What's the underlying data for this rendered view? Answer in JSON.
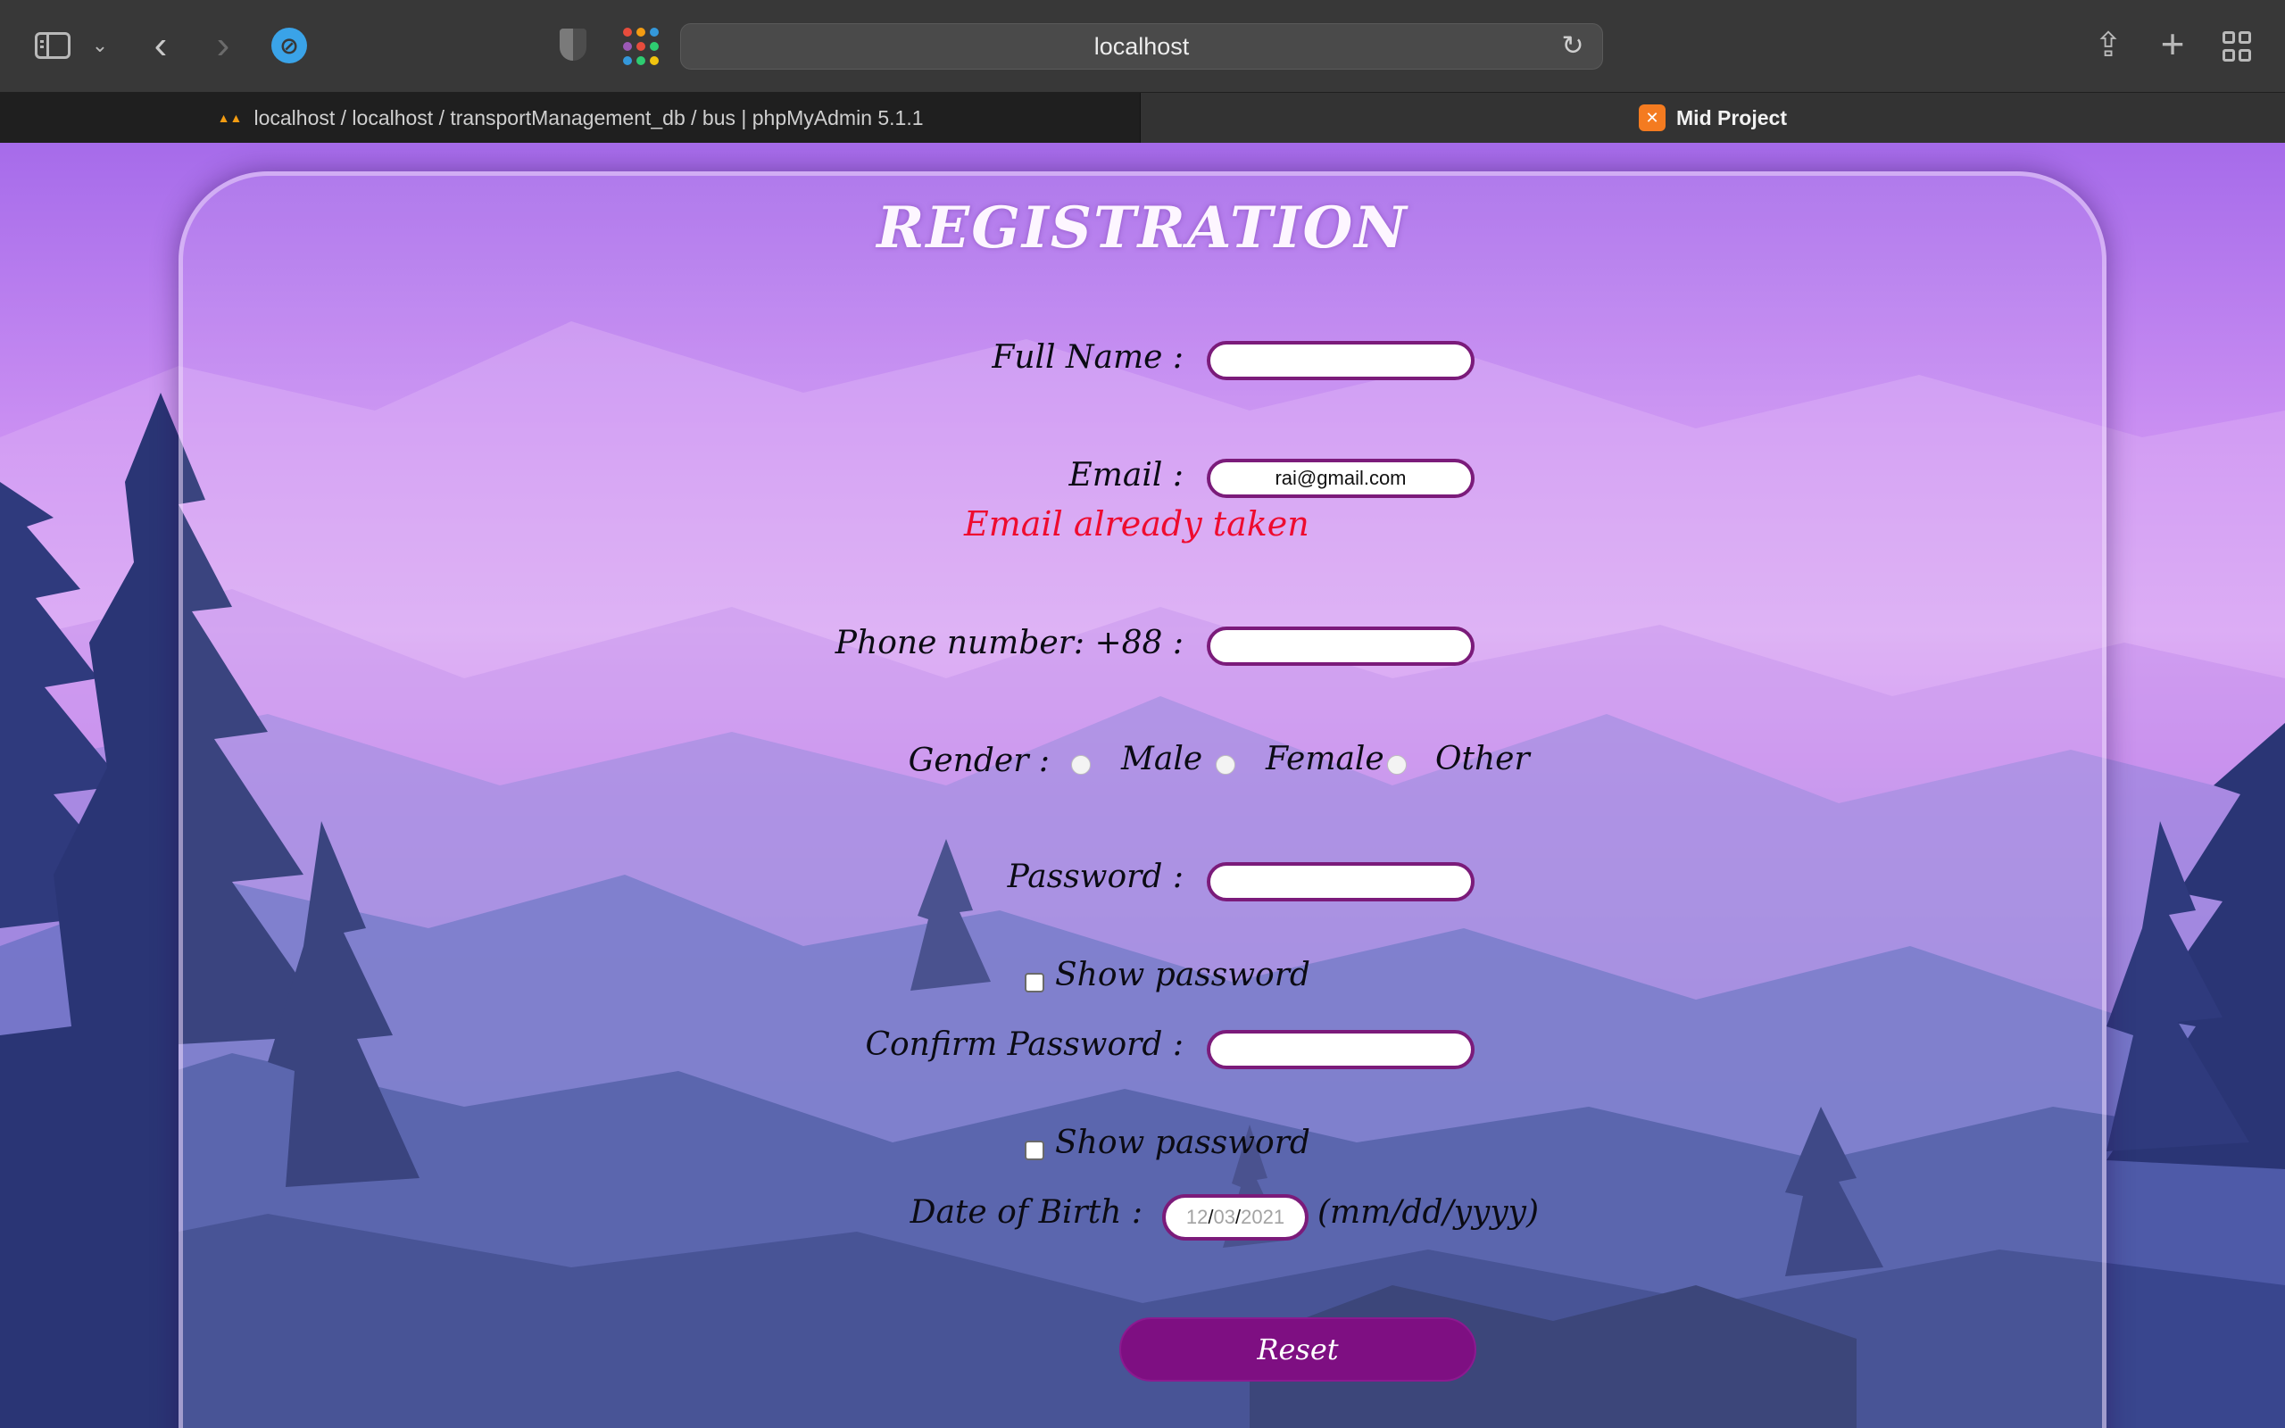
{
  "browser": {
    "address": "localhost",
    "tabs": [
      {
        "label": "localhost / localhost / transportManagement_db / bus | phpMyAdmin 5.1.1",
        "icon": "phpmyadmin-icon"
      },
      {
        "label": "Mid Project",
        "icon": "xampp-icon"
      }
    ],
    "apps_colors": [
      "#e74c3c",
      "#f39c12",
      "#3498db",
      "#9b59b6",
      "#e74c3c",
      "#2ecc71",
      "#3498db",
      "#2ecc71",
      "#f1c40f"
    ]
  },
  "form": {
    "title": "REGISTRATION",
    "full_name_label": "Full Name :",
    "full_name_value": "",
    "email_label": "Email :",
    "email_value": "rai@gmail.com",
    "email_error": "Email already taken",
    "phone_label": "Phone number: +88 :",
    "phone_value": "",
    "gender_label": "Gender :",
    "gender_options": [
      "Male",
      "Female",
      "Other"
    ],
    "password_label": "Password :",
    "show_password_label": "Show password",
    "confirm_password_label": "Confirm Password :",
    "show_password_label_2": "Show password",
    "dob_label": "Date of Birth :",
    "dob_month": "12",
    "dob_day": "03",
    "dob_year": "2021",
    "dob_hint": "(mm/dd/yyyy)",
    "reset_label": "Reset"
  },
  "colors": {
    "accent": "#7e0f82",
    "error": "#ee0b2f",
    "field_border": "#7b1b7a"
  }
}
